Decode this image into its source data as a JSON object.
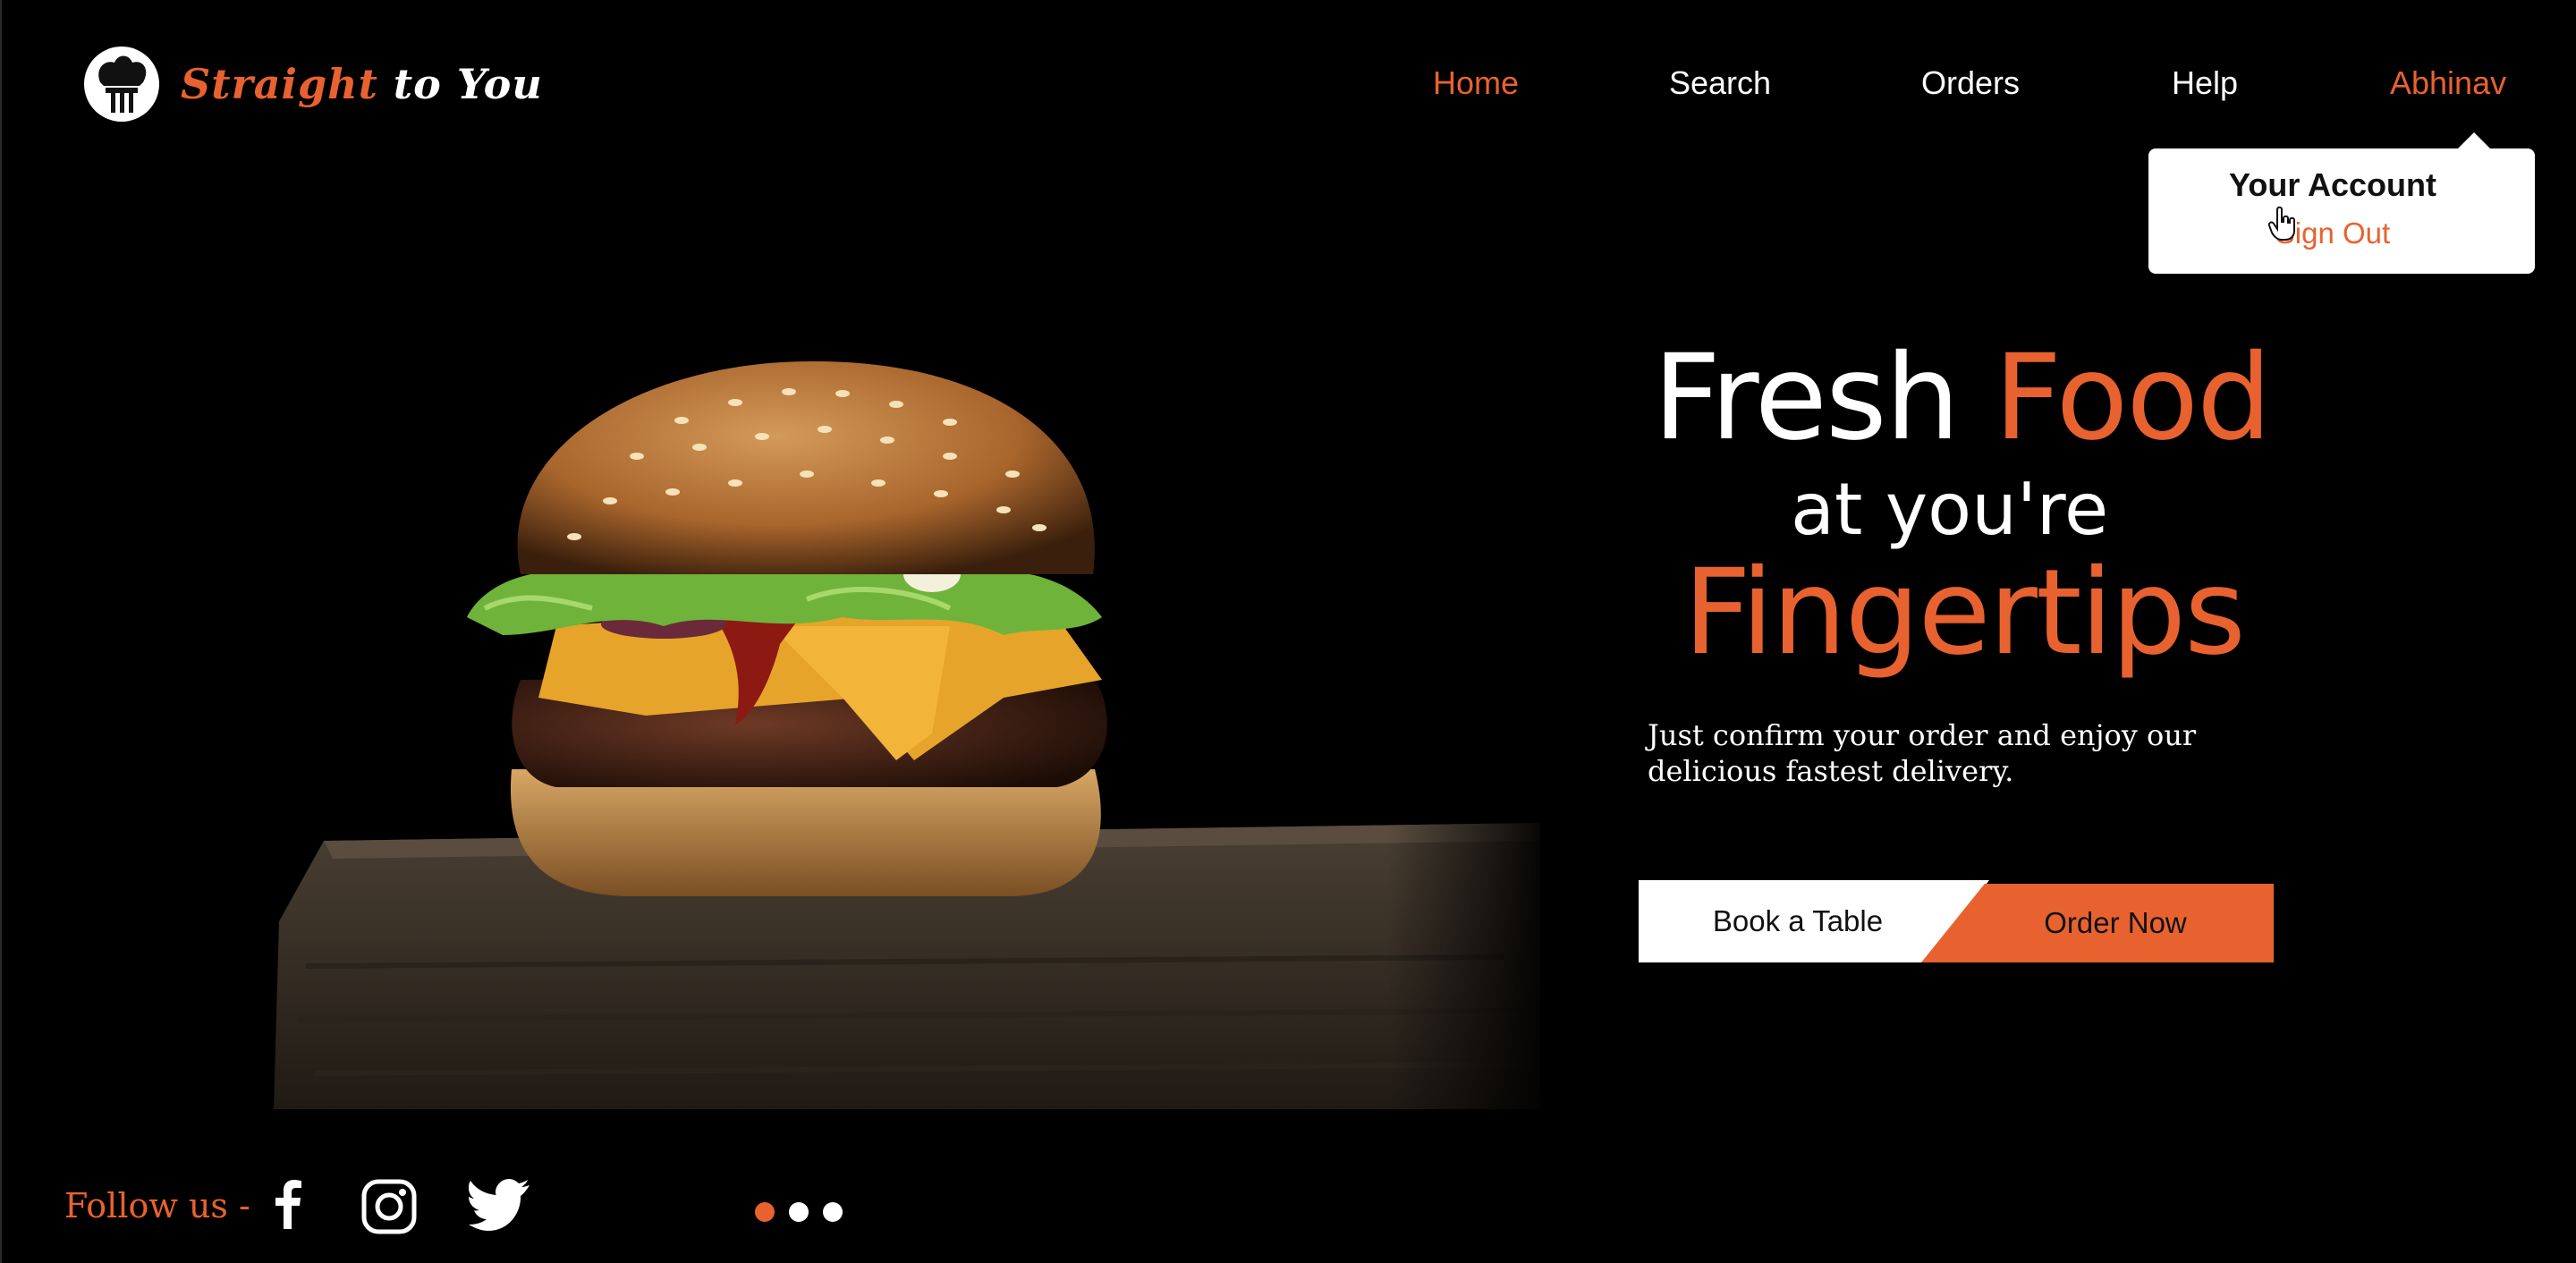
{
  "brand": {
    "logo_icon": "chef-hat-cutlery-icon",
    "word1": "Straight",
    "word2": "to",
    "word3": "You"
  },
  "nav": {
    "home": "Home",
    "search": "Search",
    "orders": "Orders",
    "help": "Help",
    "user": "Abhinav",
    "active": "Home"
  },
  "account_menu": {
    "title": "Your Account",
    "sign_out": "Sign Out"
  },
  "hero": {
    "image": "burger-photo",
    "headline_word1": "Fresh",
    "headline_word2": "Food",
    "headline_line2": "at you're",
    "headline_line3": "Fingertips",
    "subtitle": "Just confirm your order and enjoy our delicious fastest delivery."
  },
  "buttons": {
    "book": "Book a Table",
    "order": "Order Now"
  },
  "footer": {
    "follow_label": "Follow us -",
    "social": [
      "facebook-icon",
      "instagram-icon",
      "twitter-icon"
    ]
  },
  "carousel": {
    "count": 3,
    "active_index": 0
  },
  "colors": {
    "accent": "#e8622f",
    "background": "#000000",
    "text": "#ffffff"
  }
}
